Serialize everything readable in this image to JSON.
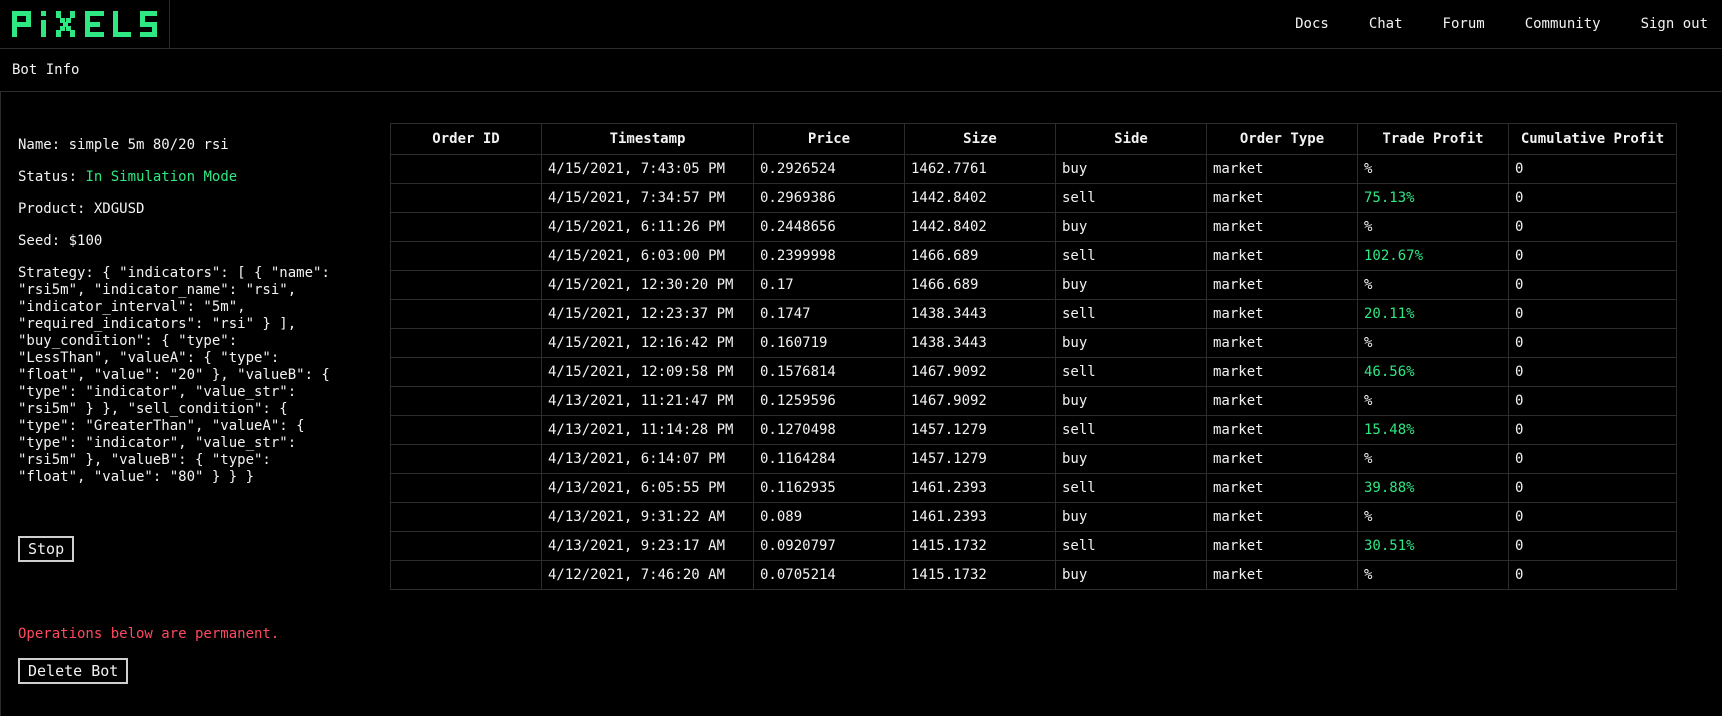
{
  "header": {
    "logo_text": "PIXELS",
    "brand_color": "#2ee882",
    "nav": [
      {
        "label": "Docs"
      },
      {
        "label": "Chat"
      },
      {
        "label": "Forum"
      },
      {
        "label": "Community"
      },
      {
        "label": "Sign out"
      }
    ]
  },
  "subheader": {
    "title": "Bot Info"
  },
  "bot": {
    "name_label": "Name:",
    "name": "simple 5m 80/20 rsi",
    "status_label": "Status:",
    "status": "In Simulation Mode",
    "status_color": "#2ee882",
    "product_label": "Product:",
    "product": "XDGUSD",
    "seed_label": "Seed:",
    "seed": "$100",
    "strategy_label": "Strategy:",
    "strategy": "{ \"indicators\": [ { \"name\": \"rsi5m\", \"indicator_name\": \"rsi\", \"indicator_interval\": \"5m\", \"required_indicators\": \"rsi\" } ], \"buy_condition\": { \"type\": \"LessThan\", \"valueA\": { \"type\": \"float\", \"value\": \"20\" }, \"valueB\": { \"type\": \"indicator\", \"value_str\": \"rsi5m\" } }, \"sell_condition\": { \"type\": \"GreaterThan\", \"valueA\": { \"type\": \"indicator\", \"value_str\": \"rsi5m\" }, \"valueB\": { \"type\": \"float\", \"value\": \"80\" } } }",
    "stop_label": "Stop",
    "warning": "Operations below are permanent.",
    "warning_color": "#ff4a5e",
    "delete_label": "Delete Bot"
  },
  "orders": {
    "columns": [
      "Order ID",
      "Timestamp",
      "Price",
      "Size",
      "Side",
      "Order Type",
      "Trade Profit",
      "Cumulative Profit"
    ],
    "rows": [
      {
        "order_id": "",
        "timestamp": "4/15/2021, 7:43:05 PM",
        "price": "0.2926524",
        "size": "1462.7761",
        "side": "buy",
        "order_type": "market",
        "trade_profit": "%",
        "cumulative_profit": "0"
      },
      {
        "order_id": "",
        "timestamp": "4/15/2021, 7:34:57 PM",
        "price": "0.2969386",
        "size": "1442.8402",
        "side": "sell",
        "order_type": "market",
        "trade_profit": "75.13%",
        "cumulative_profit": "0"
      },
      {
        "order_id": "",
        "timestamp": "4/15/2021, 6:11:26 PM",
        "price": "0.2448656",
        "size": "1442.8402",
        "side": "buy",
        "order_type": "market",
        "trade_profit": "%",
        "cumulative_profit": "0"
      },
      {
        "order_id": "",
        "timestamp": "4/15/2021, 6:03:00 PM",
        "price": "0.2399998",
        "size": "1466.689",
        "side": "sell",
        "order_type": "market",
        "trade_profit": "102.67%",
        "cumulative_profit": "0"
      },
      {
        "order_id": "",
        "timestamp": "4/15/2021, 12:30:20 PM",
        "price": "0.17",
        "size": "1466.689",
        "side": "buy",
        "order_type": "market",
        "trade_profit": "%",
        "cumulative_profit": "0"
      },
      {
        "order_id": "",
        "timestamp": "4/15/2021, 12:23:37 PM",
        "price": "0.1747",
        "size": "1438.3443",
        "side": "sell",
        "order_type": "market",
        "trade_profit": "20.11%",
        "cumulative_profit": "0"
      },
      {
        "order_id": "",
        "timestamp": "4/15/2021, 12:16:42 PM",
        "price": "0.160719",
        "size": "1438.3443",
        "side": "buy",
        "order_type": "market",
        "trade_profit": "%",
        "cumulative_profit": "0"
      },
      {
        "order_id": "",
        "timestamp": "4/15/2021, 12:09:58 PM",
        "price": "0.1576814",
        "size": "1467.9092",
        "side": "sell",
        "order_type": "market",
        "trade_profit": "46.56%",
        "cumulative_profit": "0"
      },
      {
        "order_id": "",
        "timestamp": "4/13/2021, 11:21:47 PM",
        "price": "0.1259596",
        "size": "1467.9092",
        "side": "buy",
        "order_type": "market",
        "trade_profit": "%",
        "cumulative_profit": "0"
      },
      {
        "order_id": "",
        "timestamp": "4/13/2021, 11:14:28 PM",
        "price": "0.1270498",
        "size": "1457.1279",
        "side": "sell",
        "order_type": "market",
        "trade_profit": "15.48%",
        "cumulative_profit": "0"
      },
      {
        "order_id": "",
        "timestamp": "4/13/2021, 6:14:07 PM",
        "price": "0.1164284",
        "size": "1457.1279",
        "side": "buy",
        "order_type": "market",
        "trade_profit": "%",
        "cumulative_profit": "0"
      },
      {
        "order_id": "",
        "timestamp": "4/13/2021, 6:05:55 PM",
        "price": "0.1162935",
        "size": "1461.2393",
        "side": "sell",
        "order_type": "market",
        "trade_profit": "39.88%",
        "cumulative_profit": "0"
      },
      {
        "order_id": "",
        "timestamp": "4/13/2021, 9:31:22 AM",
        "price": "0.089",
        "size": "1461.2393",
        "side": "buy",
        "order_type": "market",
        "trade_profit": "%",
        "cumulative_profit": "0"
      },
      {
        "order_id": "",
        "timestamp": "4/13/2021, 9:23:17 AM",
        "price": "0.0920797",
        "size": "1415.1732",
        "side": "sell",
        "order_type": "market",
        "trade_profit": "30.51%",
        "cumulative_profit": "0"
      },
      {
        "order_id": "",
        "timestamp": "4/12/2021, 7:46:20 AM",
        "price": "0.0705214",
        "size": "1415.1732",
        "side": "buy",
        "order_type": "market",
        "trade_profit": "%",
        "cumulative_profit": "0"
      }
    ]
  }
}
